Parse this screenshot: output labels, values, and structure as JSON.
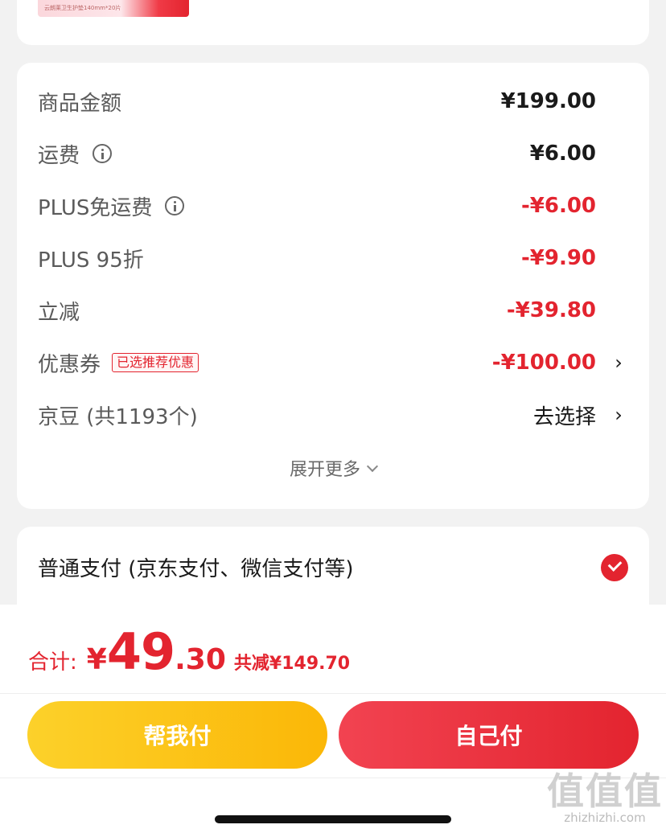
{
  "product": {
    "strip_text": "云朗莱卫生护垫140mm*20片"
  },
  "price_rows": [
    {
      "label": "商品金额",
      "value": "¥199.00",
      "info": false
    },
    {
      "label": "运费",
      "value": "¥6.00",
      "info": true
    },
    {
      "label": "PLUS免运费",
      "value": "-¥6.00",
      "info": true
    },
    {
      "label": "PLUS 95折",
      "value": "-¥9.90",
      "info": false
    },
    {
      "label": "立减",
      "value": "-¥39.80",
      "info": false
    },
    {
      "label": "优惠券",
      "badge": "已选推荐优惠",
      "value": "-¥100.00",
      "chevron": "›"
    },
    {
      "label": "京豆 (共1193个)",
      "value": "去选择",
      "chevron": "›"
    }
  ],
  "expand_label": "展开更多",
  "payment": {
    "label": "普通支付 (京东支付、微信支付等)",
    "selected": true
  },
  "total": {
    "label": "合计:",
    "currency": "¥",
    "integer": "49",
    "decimal": ".30",
    "savings": "共减¥149.70"
  },
  "buttons": {
    "help_pay": "帮我付",
    "self_pay": "自己付"
  },
  "watermark": {
    "logo": "值值值",
    "url": "zhizhizhi.com"
  },
  "colors": {
    "accent_red": "#e3242f",
    "help_yellow": "#fcc419"
  }
}
